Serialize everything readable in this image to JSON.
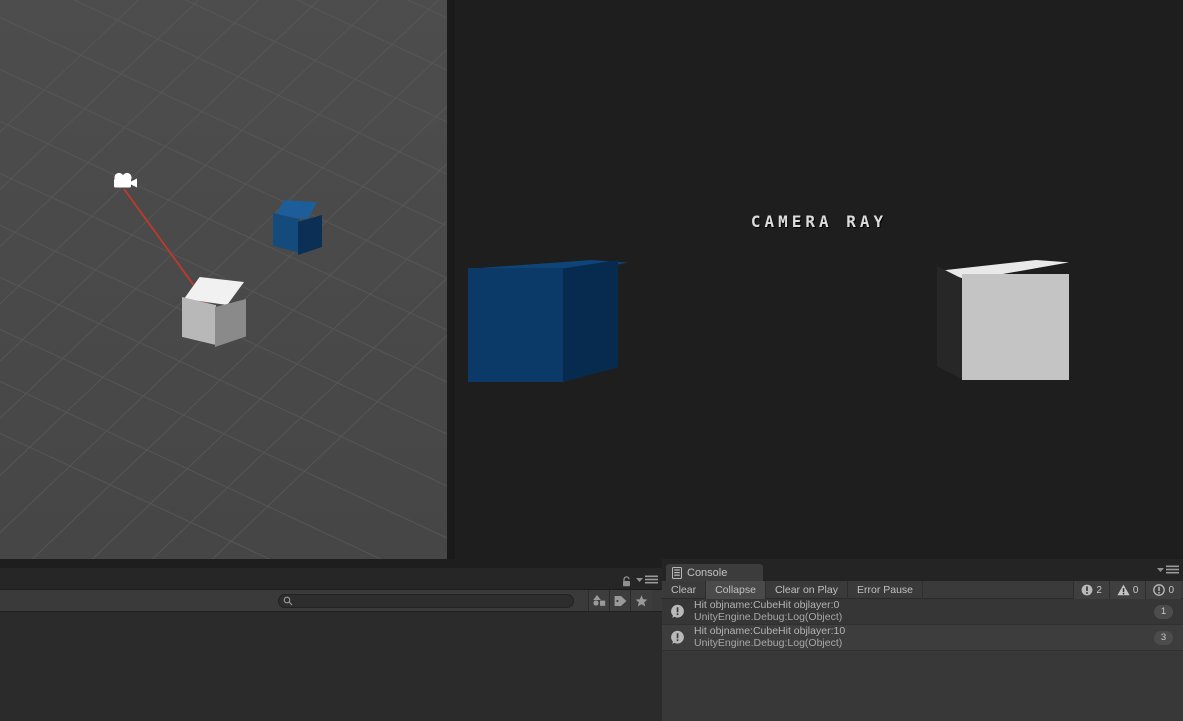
{
  "scene": {
    "name": "scene-view",
    "background_color": "#4a4a4a",
    "grid_color": "#5c5c5c",
    "gizmos": {
      "camera_gizmo": "camera-gizmo-icon",
      "ray_color": "#c0392b",
      "ray_label": "camera raycast line"
    },
    "objects": [
      {
        "name": "Cube",
        "color": "#15487a",
        "type": "cube"
      },
      {
        "name": "CubeHit",
        "color": "#d9d9d9",
        "type": "cube"
      }
    ]
  },
  "game": {
    "name": "game-view",
    "background_color": "#1e1e1e",
    "overlay_title": "CAMERA  RAY",
    "objects": [
      {
        "name": "Cube",
        "color": "#0b3a69"
      },
      {
        "name": "CubeHit",
        "color": "#c4c4c4"
      }
    ]
  },
  "left_panel": {
    "search": {
      "value": "",
      "placeholder": ""
    },
    "lock_icon": "lock-icon",
    "menu_icon": "hamburger-menu-icon",
    "filters": [
      {
        "icon": "shapes-filter-icon",
        "label": "Filter by Type"
      },
      {
        "icon": "tag-filter-icon",
        "label": "Filter by Label"
      },
      {
        "icon": "star-favorite-icon",
        "label": "Favorites"
      }
    ]
  },
  "console": {
    "tab_label": "Console",
    "tab_icon": "console-list-icon",
    "menu_icon": "hamburger-menu-icon",
    "toolbar": {
      "clear_label": "Clear",
      "collapse_label": "Collapse",
      "clear_on_play_label": "Clear on Play",
      "error_pause_label": "Error Pause",
      "active_button": "Collapse"
    },
    "counters": [
      {
        "icon": "error-icon",
        "value": "2"
      },
      {
        "icon": "warning-icon",
        "value": "0"
      },
      {
        "icon": "info-icon",
        "value": "0"
      }
    ],
    "logs": [
      {
        "icon": "log-info-icon",
        "line1": "Hit objname:CubeHit objlayer:0",
        "line2": "UnityEngine.Debug:Log(Object)",
        "count": "1"
      },
      {
        "icon": "log-info-icon",
        "line1": "Hit objname:CubeHit objlayer:10",
        "line2": "UnityEngine.Debug:Log(Object)",
        "count": "3"
      }
    ]
  }
}
